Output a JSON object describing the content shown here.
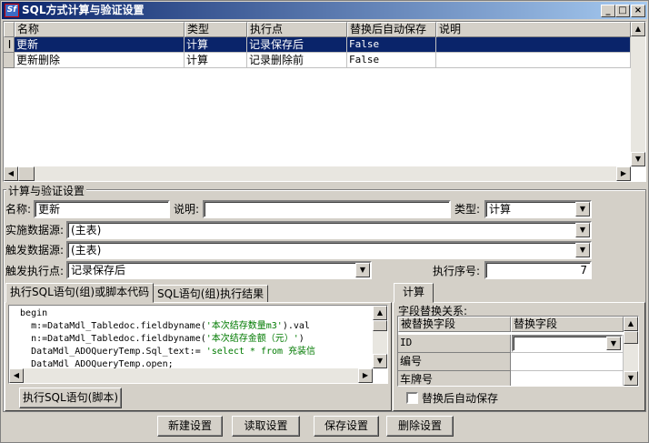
{
  "window": {
    "title": "SQL方式计算与验证设置",
    "controls": [
      "_",
      "□",
      "×"
    ],
    "app_icon_text": "Sf"
  },
  "grid": {
    "columns": [
      "名称",
      "类型",
      "执行点",
      "替换后自动保存",
      "说明"
    ],
    "rows": [
      {
        "indicator": "I",
        "name": "更新",
        "type": "计算",
        "exec_point": "记录保存后",
        "auto_save": "False",
        "desc": ""
      },
      {
        "indicator": "",
        "name": "更新删除",
        "type": "计算",
        "exec_point": "记录删除前",
        "auto_save": "False",
        "desc": ""
      }
    ]
  },
  "settings": {
    "group_label": "计算与验证设置",
    "name_label": "名称:",
    "name_value": "更新",
    "desc_label": "说明:",
    "desc_value": "",
    "type_label": "类型:",
    "type_value": "计算",
    "impl_source_label": "实施数据源:",
    "impl_source_value": "(主表)",
    "trigger_source_label": "触发数据源:",
    "trigger_source_value": "(主表)",
    "trigger_point_label": "触发执行点:",
    "trigger_point_value": "记录保存后",
    "exec_order_label": "执行序号:",
    "exec_order_value": "7"
  },
  "left_tabs": [
    "执行SQL语句(组)或脚本代码",
    "SQL语句(组)执行结果"
  ],
  "code_lines": [
    {
      "plain": "  begin",
      "green": "",
      "tail": ""
    },
    {
      "plain": "    m:=DataMdl_Tabledoc.fieldbyname(",
      "green": "'本次结存数量m3'",
      "tail": ").val"
    },
    {
      "plain": "    n:=DataMdl_Tabledoc.fieldbyname(",
      "green": "'本次结存金额（元）'",
      "tail": ")"
    },
    {
      "plain": "    DataMdl_ADOQueryTemp.Sql_text:= ",
      "green": "'select * from 充装信",
      "tail": ""
    },
    {
      "plain": "    DataMdl_ADOQueryTemp.open;",
      "green": "",
      "tail": ""
    }
  ],
  "exec_sql_button": "执行SQL语句(脚本)",
  "right_tab": "计算",
  "replace_rel_label": "字段替换关系:",
  "replace_grid": {
    "columns": [
      "被替换字段",
      "替换字段"
    ],
    "rows": [
      {
        "from": "ID",
        "to": ""
      },
      {
        "from": "编号",
        "to": ""
      },
      {
        "from": "车牌号",
        "to": ""
      }
    ]
  },
  "auto_save_checkbox_label": "替换后自动保存",
  "bottom_buttons": [
    "新建设置",
    "读取设置",
    "保存设置",
    "删除设置"
  ]
}
